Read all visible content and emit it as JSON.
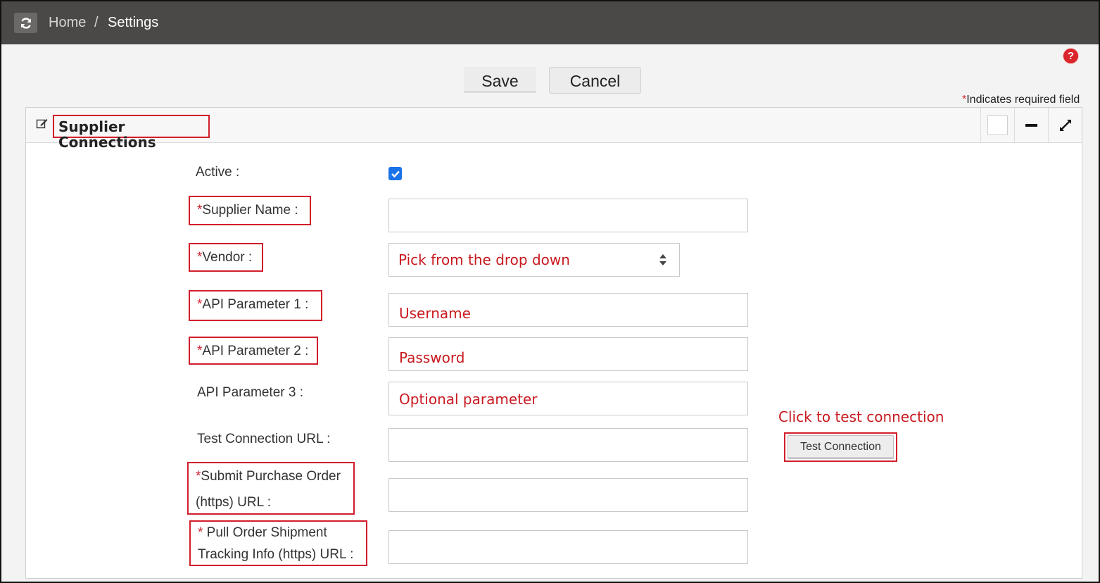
{
  "breadcrumb": {
    "home": "Home",
    "separator": "/",
    "current": "Settings"
  },
  "toolbar": {
    "save_label": "Save",
    "cancel_label": "Cancel",
    "help_glyph": "?"
  },
  "required_note": {
    "star": "*",
    "text": "Indicates required field"
  },
  "panel": {
    "title": "Supplier Connections"
  },
  "form": {
    "required_star": "*",
    "active": {
      "label": "Active :",
      "checked": true
    },
    "supplier_name": {
      "label": "Supplier Name :",
      "value": ""
    },
    "vendor": {
      "label": "Vendor :",
      "value": "Pick from the drop down"
    },
    "api_param_1": {
      "label": "API Parameter 1 :",
      "value": "Username"
    },
    "api_param_2": {
      "label": "API Parameter 2 :",
      "value": "Password"
    },
    "api_param_3": {
      "label": "API Parameter 3 :",
      "value": "Optional parameter"
    },
    "test_url": {
      "label": "Test Connection URL :",
      "value": ""
    },
    "submit_po_url": {
      "label_line1": "Submit Purchase Order",
      "label_line2": "(https) URL :",
      "value": ""
    },
    "pull_tracking_url": {
      "label_line1": " Pull Order Shipment",
      "label_line2": "Tracking Info (https) URL :",
      "value": ""
    }
  },
  "test_connection": {
    "hint": "Click to test connection",
    "button_label": "Test Connection"
  },
  "icons": [
    "refresh-icon",
    "help-icon",
    "edit-icon",
    "checkbox-icon",
    "minimize-icon",
    "expand-icon",
    "select-arrows-icon"
  ],
  "colors": {
    "topbar": "#4b4947",
    "accent_red": "#d21e2b",
    "checkbox_blue": "#1a73e8"
  }
}
